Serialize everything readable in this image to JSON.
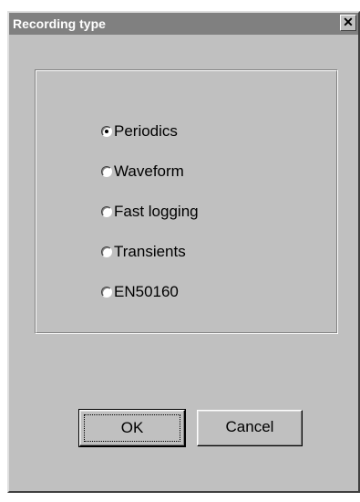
{
  "dialog": {
    "title": "Recording type",
    "close_glyph": "✕"
  },
  "options": [
    {
      "label": "Periodics",
      "selected": true
    },
    {
      "label": "Waveform",
      "selected": false
    },
    {
      "label": "Fast logging",
      "selected": false
    },
    {
      "label": "Transients",
      "selected": false
    },
    {
      "label": "EN50160",
      "selected": false
    }
  ],
  "buttons": {
    "ok": "OK",
    "cancel": "Cancel"
  }
}
